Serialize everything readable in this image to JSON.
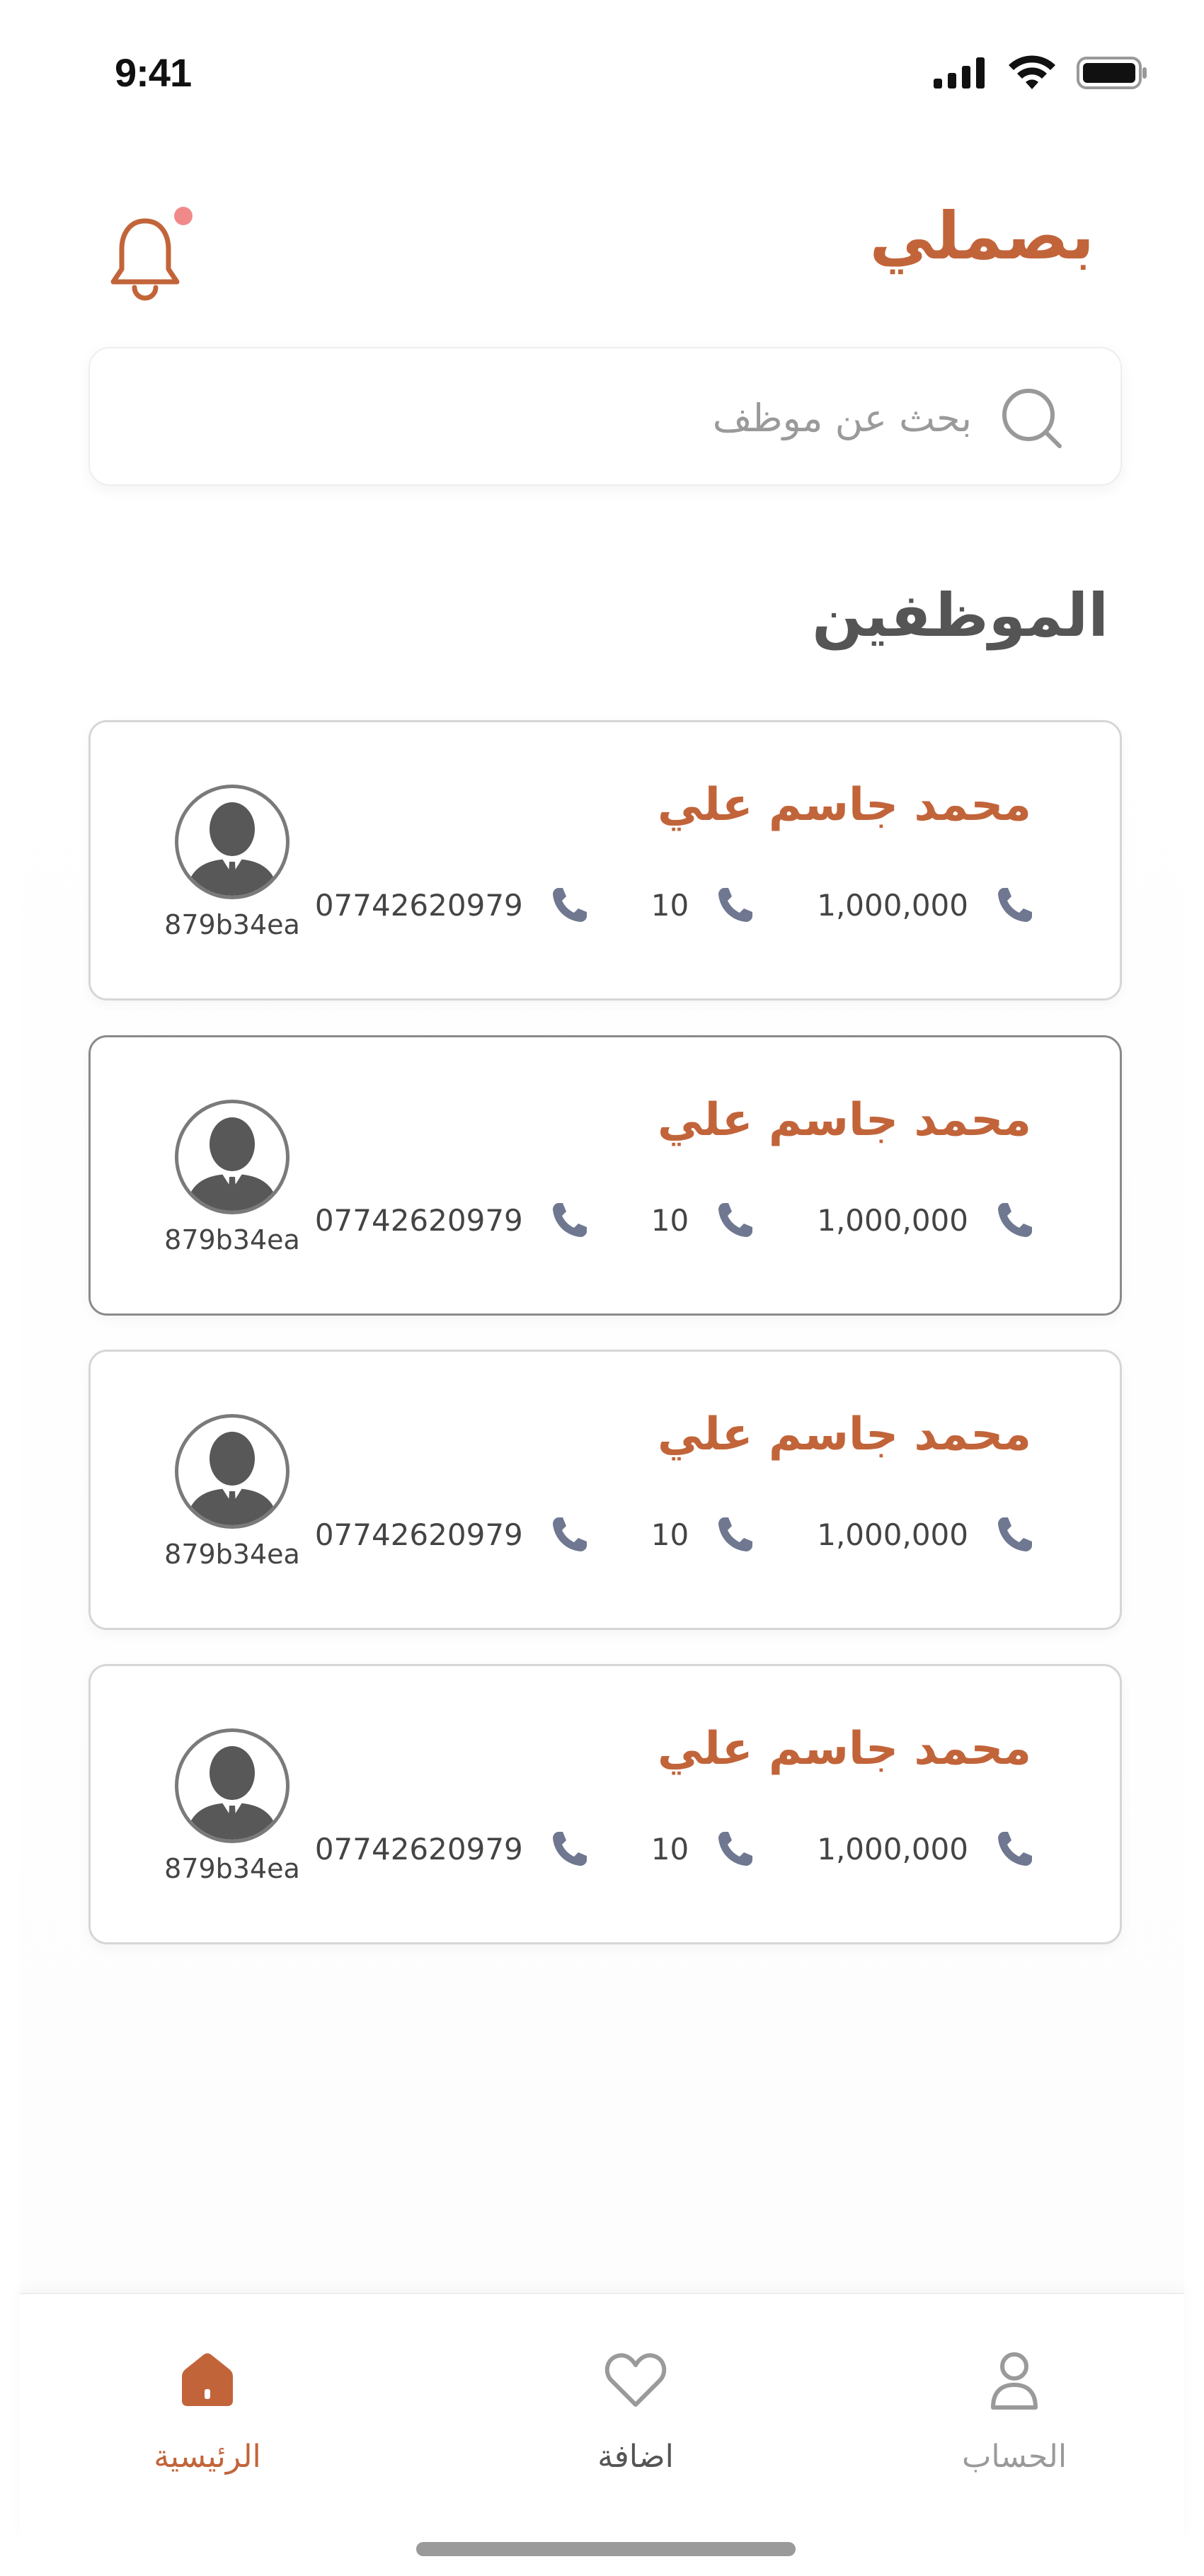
{
  "status_bar": {
    "time": "9:41"
  },
  "header": {
    "brand": "بصملي"
  },
  "search": {
    "placeholder": "بحث عن موظف"
  },
  "section": {
    "title": "الموظفين"
  },
  "employees": [
    {
      "name": "محمد جاسم علي",
      "salary": "1,000,000",
      "days": "10",
      "phone": "07742620979",
      "code": "879b34ea",
      "selected": false
    },
    {
      "name": "محمد جاسم علي",
      "salary": "1,000,000",
      "days": "10",
      "phone": "07742620979",
      "code": "879b34ea",
      "selected": true
    },
    {
      "name": "محمد جاسم علي",
      "salary": "1,000,000",
      "days": "10",
      "phone": "07742620979",
      "code": "879b34ea",
      "selected": false
    },
    {
      "name": "محمد جاسم علي",
      "salary": "1,000,000",
      "days": "10",
      "phone": "07742620979",
      "code": "879b34ea",
      "selected": false
    }
  ],
  "bottom_nav": {
    "home": {
      "label": "الرئيسية",
      "icon": "home-icon",
      "active": true
    },
    "add": {
      "label": "اضافة",
      "icon": "heart-icon",
      "active": false
    },
    "account": {
      "label": "الحساب",
      "icon": "user-icon",
      "active": false
    }
  },
  "colors": {
    "accent": "#c2643a",
    "text_dark": "#555555",
    "muted": "#9a9a9a",
    "phone_icon": "#6f7890",
    "notification_dot": "#f08a8a"
  }
}
